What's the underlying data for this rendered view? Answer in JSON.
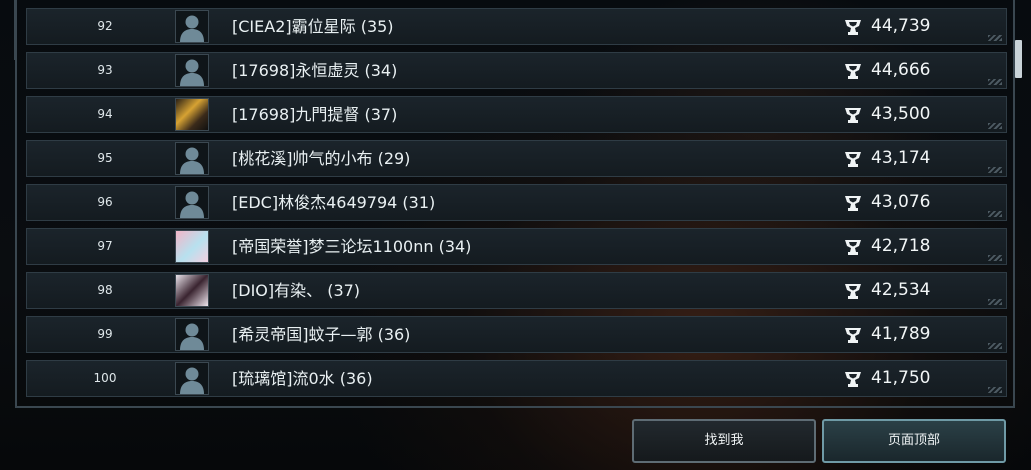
{
  "leaderboard": {
    "rows": [
      {
        "rank": "92",
        "name": "[CIEA2]霸位星际 (35)",
        "score": "44,739",
        "avatar": "silhouette"
      },
      {
        "rank": "93",
        "name": "[17698]永恒虚灵 (34)",
        "score": "44,666",
        "avatar": "silhouette"
      },
      {
        "rank": "94",
        "name": "[17698]九門提督 (37)",
        "score": "43,500",
        "avatar": "photo-a"
      },
      {
        "rank": "95",
        "name": "[桃花溪]帅气的小布 (29)",
        "score": "43,174",
        "avatar": "silhouette"
      },
      {
        "rank": "96",
        "name": "[EDC]林俊杰4649794 (31)",
        "score": "43,076",
        "avatar": "silhouette"
      },
      {
        "rank": "97",
        "name": "[帝国荣誉]梦三论坛1100nn (34)",
        "score": "42,718",
        "avatar": "photo-b"
      },
      {
        "rank": "98",
        "name": "[DIO]有染、 (37)",
        "score": "42,534",
        "avatar": "photo-c"
      },
      {
        "rank": "99",
        "name": "[希灵帝国]蚊子—郭 (36)",
        "score": "41,789",
        "avatar": "silhouette"
      },
      {
        "rank": "100",
        "name": "[琉璃馆]流0水 (36)",
        "score": "41,750",
        "avatar": "silhouette"
      }
    ],
    "score_icon": "trophy-icon"
  },
  "footer": {
    "find_me_label": "找到我",
    "page_top_label": "页面顶部"
  },
  "colors": {
    "row_bg": "#1b242b",
    "row_border": "#2f3c45",
    "accent_button_border": "#6f9aa6"
  }
}
